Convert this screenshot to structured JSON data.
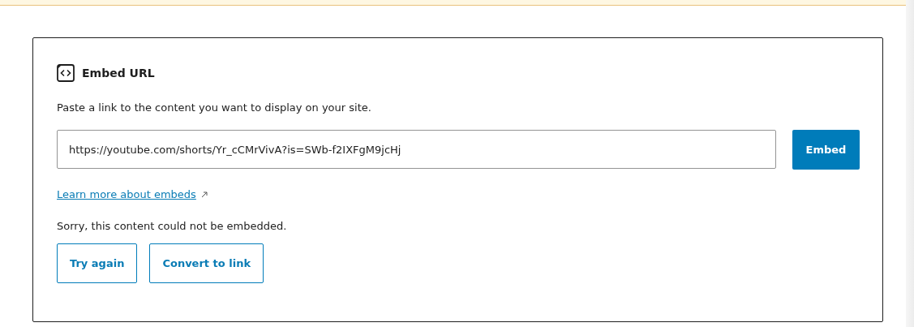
{
  "placeholder_block": {
    "title": "Embed URL",
    "instructions": "Paste a link to the content you want to display on your site.",
    "url_field": {
      "value": "https://youtube.com/shorts/Yr_cCMrVivA?is=SWb-f2IXFgM9jcHj"
    },
    "embed_button": "Embed",
    "learn_more_link": "Learn more about embeds",
    "error_message": "Sorry, this content could not be embedded.",
    "actions": [
      {
        "label": "Try again"
      },
      {
        "label": "Convert to link"
      }
    ]
  }
}
